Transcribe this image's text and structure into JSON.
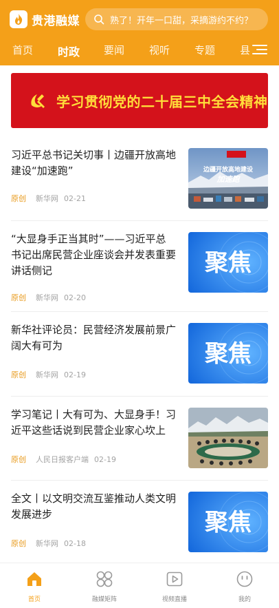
{
  "header": {
    "logo_text": "贵港融媒",
    "search_placeholder": "熟了！开年一口甜，采摘游约不约？"
  },
  "tabs": [
    {
      "label": "首页",
      "active": false
    },
    {
      "label": "时政",
      "active": true
    },
    {
      "label": "要闻",
      "active": false
    },
    {
      "label": "视听",
      "active": false
    },
    {
      "label": "专题",
      "active": false
    },
    {
      "label": "县",
      "active": false
    }
  ],
  "banner": {
    "text": "学习贯彻党的二十届三中全会精神"
  },
  "news": [
    {
      "title": "习近平总书记关切事丨边疆开放高地建设“加速跑”",
      "tag": "原创",
      "source": "新华网",
      "date": "02-21",
      "thumb": "photo-border",
      "thumb_caption": "边疆开放高地建设",
      "thumb_subcaption": "加速跑"
    },
    {
      "title": "“大显身手正当其时”——习近平总书记出席民营企业座谈会并发表重要讲话侧记",
      "tag": "原创",
      "source": "新华网",
      "date": "02-20",
      "thumb": "focus",
      "thumb_caption": "聚焦"
    },
    {
      "title": "新华社评论员：民营经济发展前景广阔大有可为",
      "tag": "原创",
      "source": "新华网",
      "date": "02-19",
      "thumb": "focus",
      "thumb_caption": "聚焦"
    },
    {
      "title": "学习笔记丨大有可为、大显身手！习近平这些话说到民营企业家心坎上",
      "tag": "原创",
      "source": "人民日报客户端",
      "date": "02-19",
      "thumb": "photo-meeting"
    },
    {
      "title": "全文丨以文明交流互鉴推动人类文明发展进步",
      "tag": "原创",
      "source": "新华网",
      "date": "02-18",
      "thumb": "focus",
      "thumb_caption": "聚焦"
    }
  ],
  "bottom_nav": [
    {
      "label": "首页",
      "icon": "home-icon",
      "active": true
    },
    {
      "label": "融媒矩阵",
      "icon": "matrix-icon",
      "active": false
    },
    {
      "label": "视频直播",
      "icon": "video-play-icon",
      "active": false
    },
    {
      "label": "我的",
      "icon": "profile-icon",
      "active": false
    }
  ],
  "colors": {
    "brand": "#f4a019",
    "banner_red": "#d4121b",
    "banner_text": "#ffde3a",
    "tag_original": "#e89a1c",
    "focus_blue": "#1677e8"
  }
}
